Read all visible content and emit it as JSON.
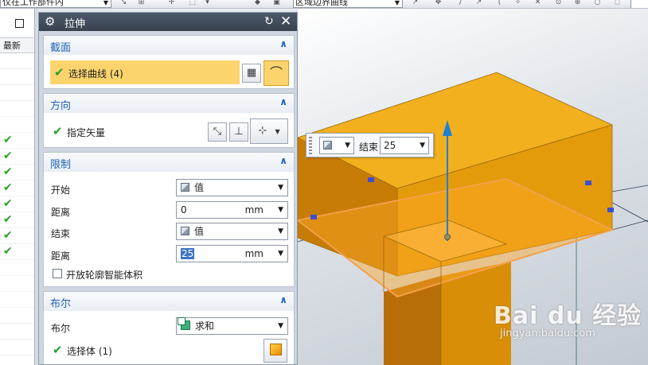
{
  "toolbar": {
    "filter_select": "仅在工作部件内",
    "curve_rule_select": "区域边界曲线"
  },
  "navigator": {
    "column_header": "最新",
    "check_glyph": "✔"
  },
  "dialog": {
    "title": "拉伸",
    "section": {
      "title": "截面",
      "select_curve": "选择曲线 (4)"
    },
    "direction": {
      "title": "方向",
      "specify_vector": "指定矢量"
    },
    "limits": {
      "title": "限制",
      "start_label": "开始",
      "start_value": "值",
      "start_distance_label": "距离",
      "start_distance": "0",
      "end_label": "结束",
      "end_value": "值",
      "end_distance_label": "距离",
      "end_distance": "25",
      "unit": "mm",
      "open_profile": "开放轮廓智能体积"
    },
    "boolean": {
      "title": "布尔",
      "boolean_label": "布尔",
      "boolean_value": "求和",
      "select_body": "选择体 (1)"
    }
  },
  "float_toolbar": {
    "end_label": "结束",
    "end_value": "25"
  },
  "watermark": {
    "brand": "Bai du 经验",
    "url": "jingyan.baidu.com"
  },
  "colors": {
    "title_bar": "#3f4a57",
    "section_title": "#1f63b5",
    "highlight": "#fbd46d",
    "check_green": "#2aa02a",
    "solid_top": "#f2b01e",
    "solid_side": "#d98e08",
    "preview_edge": "#f5a04a",
    "vector_blue": "#1e7fd8"
  }
}
